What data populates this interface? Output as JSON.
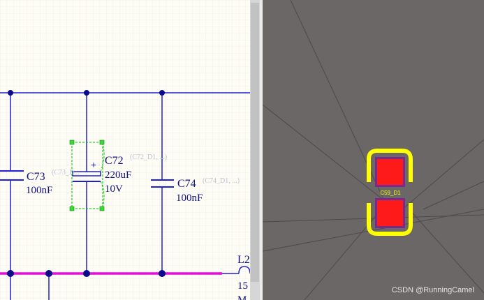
{
  "schematic": {
    "components": [
      {
        "designator": "C73",
        "value": "100nF",
        "param": "(C73_D..."
      },
      {
        "designator": "C72",
        "value": "220uF",
        "voltage": "10V",
        "param": "(C72_D1, ...)",
        "polarity": "+"
      },
      {
        "designator": "C74",
        "value": "100nF",
        "param": "(C74_D1, ...)"
      },
      {
        "designator": "L2",
        "value": "15",
        "extra": "M"
      }
    ],
    "colors": {
      "background": "#fdfcf5",
      "wire": "#1f1fd6",
      "power_net": "#e010d8",
      "junction": "#0a0a8a",
      "selection": "#00c000"
    }
  },
  "pcb": {
    "footprint_label": "C59_D1",
    "colors": {
      "background": "#6b6766",
      "pad": "#ff1a1a",
      "pad_outline": "#7a2a8a",
      "silkscreen": "#ffff00"
    }
  },
  "watermark": "CSDN @RunningCamel"
}
